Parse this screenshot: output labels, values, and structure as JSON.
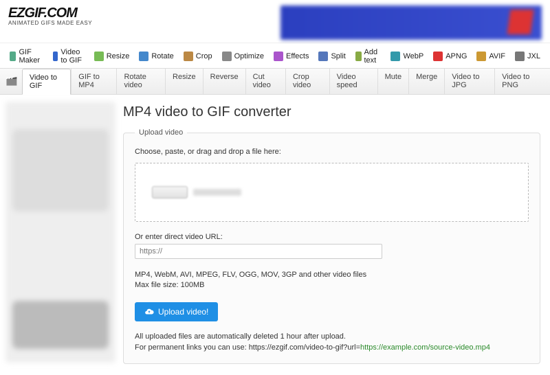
{
  "logo": {
    "title": "EZGIF.COM",
    "tagline": "ANIMATED GIFS MADE EASY"
  },
  "nav_primary": [
    {
      "label": "GIF Maker",
      "color": "#5a8"
    },
    {
      "label": "Video to GIF",
      "color": "#36c"
    },
    {
      "label": "Resize",
      "color": "#7b5"
    },
    {
      "label": "Rotate",
      "color": "#48c"
    },
    {
      "label": "Crop",
      "color": "#b84"
    },
    {
      "label": "Optimize",
      "color": "#888"
    },
    {
      "label": "Effects",
      "color": "#a5c"
    },
    {
      "label": "Split",
      "color": "#57b"
    },
    {
      "label": "Add text",
      "color": "#8a4"
    },
    {
      "label": "WebP",
      "color": "#39a"
    },
    {
      "label": "APNG",
      "color": "#d33"
    },
    {
      "label": "AVIF",
      "color": "#c93"
    },
    {
      "label": "JXL",
      "color": "#777"
    }
  ],
  "nav_secondary": [
    "Video to GIF",
    "GIF to MP4",
    "Rotate video",
    "Resize",
    "Reverse",
    "Cut video",
    "Crop video",
    "Video speed",
    "Mute",
    "Merge",
    "Video to JPG",
    "Video to PNG"
  ],
  "active_secondary": 0,
  "page": {
    "title": "MP4 video to GIF converter",
    "fieldset_legend": "Upload video",
    "choose_label": "Choose, paste, or drag and drop a file here:",
    "url_label": "Or enter direct video URL:",
    "url_placeholder": "https://",
    "formats_line": "MP4, WebM, AVI, MPEG, FLV, OGG, MOV, 3GP and other video files",
    "maxsize_line": "Max file size: 100MB",
    "upload_button": "Upload video!",
    "footnote_1": "All uploaded files are automatically deleted 1 hour after upload.",
    "footnote_2a": "For permanent links you can use: https://ezgif.com/video-to-gif?url=",
    "footnote_2b": "https://example.com/source-video.mp4"
  }
}
